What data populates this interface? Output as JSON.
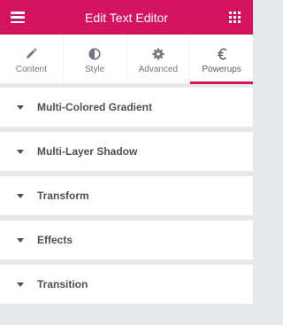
{
  "header": {
    "title": "Edit Text Editor",
    "menu_icon": "hamburger-icon",
    "apps_icon": "grid-icon",
    "color": "#d5145f"
  },
  "tabs": [
    {
      "label": "Content",
      "icon": "pencil-icon"
    },
    {
      "label": "Style",
      "icon": "half-circle-icon"
    },
    {
      "label": "Advanced",
      "icon": "gear-icon"
    },
    {
      "label": "Powerups",
      "icon": "euro-icon",
      "active": true
    }
  ],
  "sections": [
    {
      "label": "Multi-Colored Gradient"
    },
    {
      "label": "Multi-Layer Shadow"
    },
    {
      "label": "Transform"
    },
    {
      "label": "Effects"
    },
    {
      "label": "Transition"
    }
  ]
}
